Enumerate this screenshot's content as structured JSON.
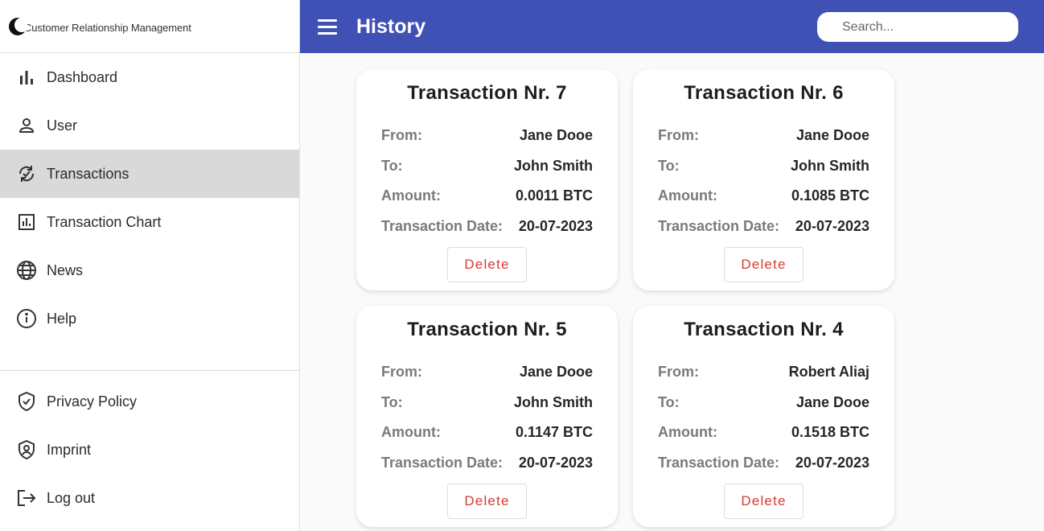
{
  "brand": {
    "logo_text": "Customer Relationship Management"
  },
  "header": {
    "title": "History",
    "search_placeholder": "Search..."
  },
  "nav": {
    "main": [
      {
        "label": "Dashboard",
        "icon": "bar-chart-icon"
      },
      {
        "label": "User",
        "icon": "person-icon"
      },
      {
        "label": "Transactions",
        "icon": "transactions-icon",
        "active": true
      },
      {
        "label": "Transaction Chart",
        "icon": "chart-box-icon"
      },
      {
        "label": "News",
        "icon": "globe-icon"
      },
      {
        "label": "Help",
        "icon": "info-icon"
      }
    ],
    "footer": [
      {
        "label": "Privacy Policy",
        "icon": "shield-check-icon"
      },
      {
        "label": "Imprint",
        "icon": "shield-person-icon"
      },
      {
        "label": "Log out",
        "icon": "logout-icon"
      }
    ]
  },
  "field_labels": {
    "from": "From:",
    "to": "To:",
    "amount": "Amount:",
    "date": "Transaction Date:"
  },
  "delete_label": "Delete",
  "transactions": [
    {
      "title": "Transaction Nr. 7",
      "from": "Jane Dooe",
      "to": "John Smith",
      "amount": "0.0011 BTC",
      "date": "20-07-2023"
    },
    {
      "title": "Transaction Nr. 6",
      "from": "Jane Dooe",
      "to": "John Smith",
      "amount": "0.1085 BTC",
      "date": "20-07-2023"
    },
    {
      "title": "Transaction Nr. 5",
      "from": "Jane Dooe",
      "to": "John Smith",
      "amount": "0.1147 BTC",
      "date": "20-07-2023"
    },
    {
      "title": "Transaction Nr. 4",
      "from": "Robert Aliaj",
      "to": "Jane Dooe",
      "amount": "0.1518 BTC",
      "date": "20-07-2023"
    }
  ],
  "colors": {
    "header": "#3f51b5",
    "active_nav": "#d9d9d9",
    "delete_text": "#d93b2f"
  }
}
